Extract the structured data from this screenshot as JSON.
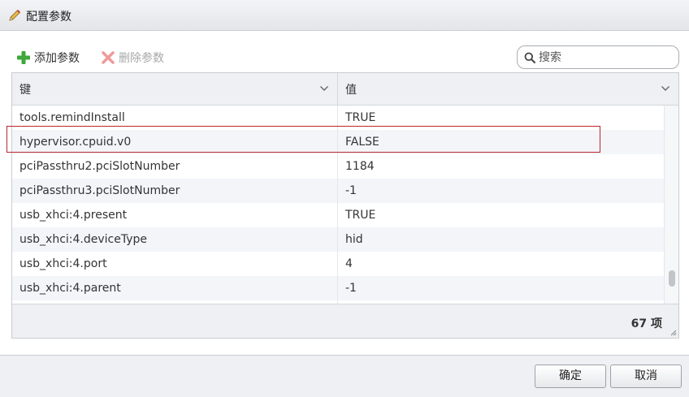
{
  "window": {
    "title": "配置参数",
    "icon": "pencil-icon"
  },
  "toolbar": {
    "add_label": "添加参数",
    "add_icon": "plus-icon",
    "delete_label": "删除参数",
    "delete_icon": "delete-x-icon"
  },
  "search": {
    "placeholder": "搜索",
    "value": "",
    "icon": "search-icon"
  },
  "grid": {
    "columns": [
      {
        "label": "键"
      },
      {
        "label": "值"
      }
    ],
    "rows": [
      {
        "key": "tools.remindInstall",
        "value": "TRUE"
      },
      {
        "key": "hypervisor.cpuid.v0",
        "value": "FALSE"
      },
      {
        "key": "pciPassthru2.pciSlotNumber",
        "value": "1184"
      },
      {
        "key": "pciPassthru3.pciSlotNumber",
        "value": "-1"
      },
      {
        "key": "usb_xhci:4.present",
        "value": "TRUE"
      },
      {
        "key": "usb_xhci:4.deviceType",
        "value": "hid"
      },
      {
        "key": "usb_xhci:4.port",
        "value": "4"
      },
      {
        "key": "usb_xhci:4.parent",
        "value": "-1"
      },
      {
        "key": "",
        "value": ""
      }
    ],
    "highlighted_row": "hypervisor.cpuid.v0",
    "highlight_color": "#b8262e",
    "count_label": "67 项"
  },
  "buttons": {
    "ok": "确定",
    "cancel": "取消"
  }
}
